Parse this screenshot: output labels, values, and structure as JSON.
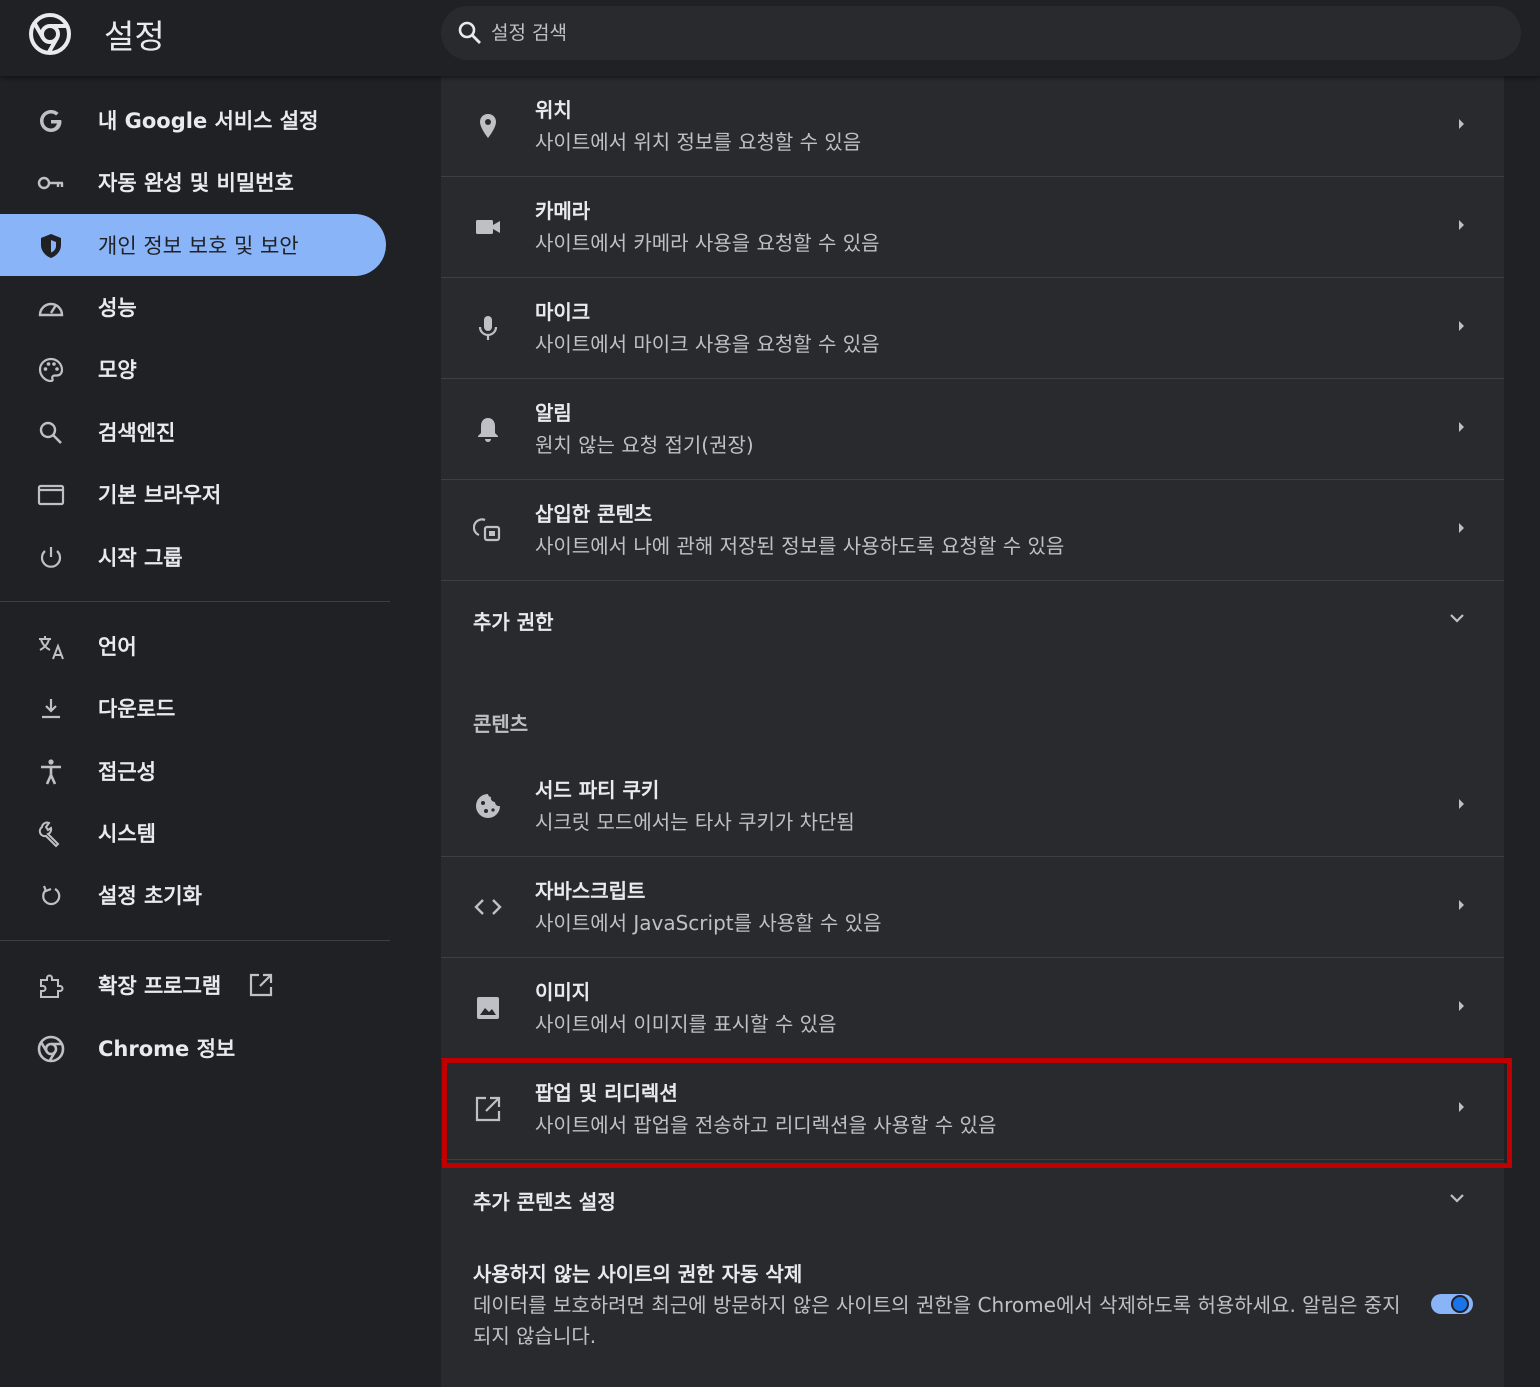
{
  "header": {
    "title": "설정",
    "search_placeholder": "설정 검색"
  },
  "sidebar": {
    "items": [
      {
        "label": "내 Google 서비스 설정",
        "icon": "google-g-icon"
      },
      {
        "label": "자동 완성 및 비밀번호",
        "icon": "key-icon"
      },
      {
        "label": "개인 정보 보호 및 보안",
        "icon": "shield-icon",
        "active": true
      },
      {
        "label": "성능",
        "icon": "speedometer-icon"
      },
      {
        "label": "모양",
        "icon": "palette-icon"
      },
      {
        "label": "검색엔진",
        "icon": "search-icon"
      },
      {
        "label": "기본 브라우저",
        "icon": "browser-window-icon"
      },
      {
        "label": "시작 그룹",
        "icon": "power-icon"
      },
      {
        "label": "언어",
        "icon": "translate-icon"
      },
      {
        "label": "다운로드",
        "icon": "download-icon"
      },
      {
        "label": "접근성",
        "icon": "accessibility-icon"
      },
      {
        "label": "시스템",
        "icon": "wrench-icon"
      },
      {
        "label": "설정 초기화",
        "icon": "reset-icon"
      },
      {
        "label": "확장 프로그램",
        "icon": "puzzle-icon",
        "external": true
      },
      {
        "label": "Chrome 정보",
        "icon": "chrome-icon"
      }
    ]
  },
  "permissions": [
    {
      "title": "위치",
      "subtitle": "사이트에서 위치 정보를 요청할 수 있음",
      "icon": "location-pin-icon"
    },
    {
      "title": "카메라",
      "subtitle": "사이트에서 카메라 사용을 요청할 수 있음",
      "icon": "camera-icon"
    },
    {
      "title": "마이크",
      "subtitle": "사이트에서 마이크 사용을 요청할 수 있음",
      "icon": "microphone-icon"
    },
    {
      "title": "알림",
      "subtitle": "원치 않는 요청 접기(권장)",
      "icon": "bell-icon"
    },
    {
      "title": "삽입한 콘텐츠",
      "subtitle": "사이트에서 나에 관해 저장된 정보를 사용하도록 요청할 수 있음",
      "icon": "embedded-content-icon"
    }
  ],
  "additional_permissions": "추가 권한",
  "content_section_label": "콘텐츠",
  "content": [
    {
      "title": "서드 파티 쿠키",
      "subtitle": "시크릿 모드에서는 타사 쿠키가 차단됨",
      "icon": "cookie-icon"
    },
    {
      "title": "자바스크립트",
      "subtitle": "사이트에서 JavaScript를 사용할 수 있음",
      "icon": "code-icon"
    },
    {
      "title": "이미지",
      "subtitle": "사이트에서 이미지를 표시할 수 있음",
      "icon": "image-icon"
    },
    {
      "title": "팝업 및 리디렉션",
      "subtitle": "사이트에서 팝업을 전송하고 리디렉션을 사용할 수 있음",
      "icon": "popup-icon"
    }
  ],
  "additional_content": "추가 콘텐츠 설정",
  "auto_revoke": {
    "title": "사용하지 않는 사이트의 권한 자동 삭제",
    "description": "데이터를 보호하려면 최근에 방문하지 않은 사이트의 권한을 Chrome에서 삭제하도록 허용하세요. 알림은 중지되지 않습니다.",
    "enabled": true
  },
  "colors": {
    "accent": "#8ab4f8",
    "highlight_box": "#c00000",
    "background": "#202124",
    "card": "#292a2d"
  }
}
